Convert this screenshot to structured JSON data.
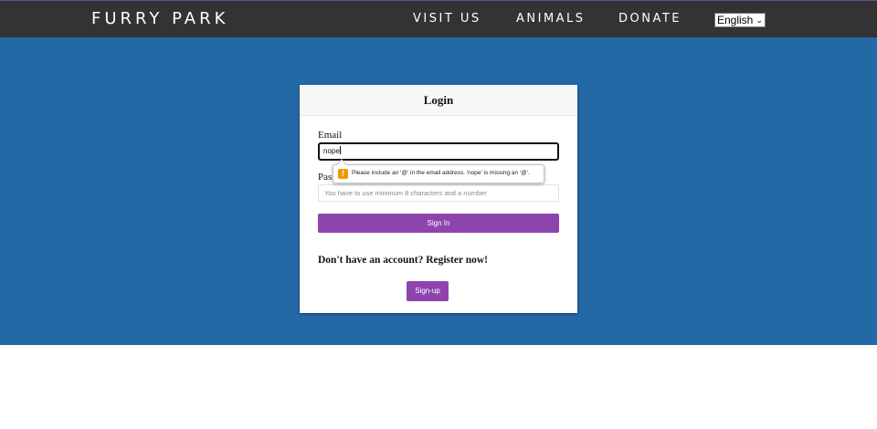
{
  "nav": {
    "brand": "Furry Park",
    "links": [
      "Visit Us",
      "Animals",
      "Donate"
    ],
    "language": "English"
  },
  "login": {
    "title": "Login",
    "email_label": "Email",
    "email_value": "nope",
    "password_label": "Password",
    "password_placeholder": "You have to use minimum 8 characters and a number",
    "signin_label": "Sign In",
    "register_prompt": "Don't have an account? Register now!",
    "signup_label": "Sign-up"
  },
  "tooltip": {
    "icon": "warning-icon",
    "message": "Please include an '@' in the email address. 'nope' is missing an '@'."
  },
  "colors": {
    "navbar": "#333333",
    "hero": "#2369a6",
    "accent": "#8e44ad",
    "warning": "#f29900"
  }
}
